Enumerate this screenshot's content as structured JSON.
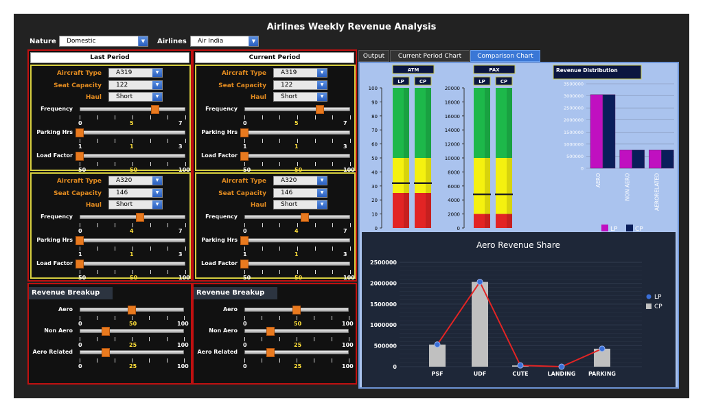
{
  "title": "Airlines Weekly Revenue Analysis",
  "filters": {
    "nature_label": "Nature",
    "nature_value": "Domestic",
    "airlines_label": "Airlines",
    "airlines_value": "Air India"
  },
  "periods": [
    {
      "header": "Last Period",
      "aircraft": [
        {
          "type_label": "Aircraft Type",
          "type_value": "A319",
          "seat_label": "Seat Capacity",
          "seat_value": "122",
          "haul_label": "Haul",
          "haul_value": "Short",
          "sliders": [
            {
              "label": "Frequency",
              "min": "0",
              "mid": "5",
              "max": "7",
              "frac": 0.714
            },
            {
              "label": "Parking Hrs",
              "min": "1",
              "mid": "1",
              "max": "3",
              "frac": 0.0
            },
            {
              "label": "Load Factor",
              "min": "50",
              "mid": "50",
              "max": "100",
              "frac": 0.0
            }
          ]
        },
        {
          "type_label": "Aircraft Type",
          "type_value": "A320",
          "seat_label": "Seat Capacity",
          "seat_value": "146",
          "haul_label": "Haul",
          "haul_value": "Short",
          "sliders": [
            {
              "label": "Frequency",
              "min": "0",
              "mid": "4",
              "max": "7",
              "frac": 0.571
            },
            {
              "label": "Parking Hrs",
              "min": "1",
              "mid": "1",
              "max": "3",
              "frac": 0.0
            },
            {
              "label": "Load Factor",
              "min": "50",
              "mid": "50",
              "max": "100",
              "frac": 0.0
            }
          ]
        }
      ],
      "revenue": {
        "title": "Revenue Breakup",
        "sliders": [
          {
            "label": "Aero",
            "min": "0",
            "mid": "50",
            "max": "100",
            "frac": 0.5
          },
          {
            "label": "Non Aero",
            "min": "0",
            "mid": "25",
            "max": "100",
            "frac": 0.25
          },
          {
            "label": "Aero Related",
            "min": "0",
            "mid": "25",
            "max": "100",
            "frac": 0.25
          }
        ]
      }
    },
    {
      "header": "Current Period",
      "aircraft": [
        {
          "type_label": "Aircraft Type",
          "type_value": "A319",
          "seat_label": "Seat Capacity",
          "seat_value": "122",
          "haul_label": "Haul",
          "haul_value": "Short",
          "sliders": [
            {
              "label": "Frequency",
              "min": "0",
              "mid": "5",
              "max": "7",
              "frac": 0.714
            },
            {
              "label": "Parking Hrs",
              "min": "1",
              "mid": "1",
              "max": "3",
              "frac": 0.0
            },
            {
              "label": "Load Factor",
              "min": "50",
              "mid": "50",
              "max": "100",
              "frac": 0.0
            }
          ]
        },
        {
          "type_label": "Aircraft Type",
          "type_value": "A320",
          "seat_label": "Seat Capacity",
          "seat_value": "146",
          "haul_label": "Haul",
          "haul_value": "Short",
          "sliders": [
            {
              "label": "Frequency",
              "min": "0",
              "mid": "4",
              "max": "7",
              "frac": 0.571
            },
            {
              "label": "Parking Hrs",
              "min": "1",
              "mid": "1",
              "max": "3",
              "frac": 0.0
            },
            {
              "label": "Load Factor",
              "min": "50",
              "mid": "50",
              "max": "100",
              "frac": 0.0
            }
          ]
        }
      ],
      "revenue": {
        "title": "Revenue Breakup",
        "sliders": [
          {
            "label": "Aero",
            "min": "0",
            "mid": "50",
            "max": "100",
            "frac": 0.5
          },
          {
            "label": "Non Aero",
            "min": "0",
            "mid": "25",
            "max": "100",
            "frac": 0.25
          },
          {
            "label": "Aero Related",
            "min": "0",
            "mid": "25",
            "max": "100",
            "frac": 0.25
          }
        ]
      }
    }
  ],
  "tabs": [
    {
      "label": "Output",
      "active": false
    },
    {
      "label": "Current Period Chart",
      "active": false
    },
    {
      "label": "Comparison Chart",
      "active": true
    }
  ],
  "chart_data": [
    {
      "type": "bar",
      "title": "ATM",
      "series_labels": [
        "LP",
        "CP"
      ],
      "ylim": [
        0,
        100
      ],
      "ticks": [
        "0",
        "10",
        "20",
        "30",
        "40",
        "50",
        "60",
        "70",
        "80",
        "90",
        "100"
      ],
      "bands": {
        "red": [
          0,
          25
        ],
        "yellow": [
          25,
          50
        ],
        "green": [
          50,
          100
        ]
      },
      "values": {
        "LP": 32,
        "CP": 32
      }
    },
    {
      "type": "bar",
      "title": "PAX",
      "series_labels": [
        "LP",
        "CP"
      ],
      "ylim": [
        0,
        20000
      ],
      "ticks": [
        "0",
        "2000",
        "4000",
        "6000",
        "8000",
        "10000",
        "12000",
        "14000",
        "16000",
        "18000",
        "20000"
      ],
      "bands": {
        "red": [
          0,
          2000
        ],
        "yellow": [
          2000,
          10000
        ],
        "green": [
          10000,
          20000
        ]
      },
      "values": {
        "LP": 4800,
        "CP": 4800
      }
    },
    {
      "type": "bar",
      "title": "Revenue Distribution",
      "categories": [
        "AERO",
        "NON AERO",
        "AERORELATED"
      ],
      "ticks": [
        "0",
        "500000",
        "1000000",
        "1500000",
        "2000000",
        "2500000",
        "3000000",
        "3500000"
      ],
      "ylim": [
        0,
        3500000
      ],
      "series": [
        {
          "name": "LP",
          "color": "#c010c0",
          "values": [
            3050000,
            760000,
            760000
          ]
        },
        {
          "name": "CP",
          "color": "#0a1e5a",
          "values": [
            3050000,
            760000,
            760000
          ]
        }
      ]
    },
    {
      "type": "bar",
      "title": "Aero Revenue Share",
      "categories": [
        "PSF",
        "UDF",
        "CUTE",
        "LANDING",
        "PARKING"
      ],
      "ticks": [
        "0",
        "500000",
        "1000000",
        "1500000",
        "2000000",
        "2500000"
      ],
      "ylim": [
        0,
        2500000
      ],
      "series": [
        {
          "name": "LP",
          "type": "line",
          "color": "#3a6fd8",
          "values": [
            530000,
            2030000,
            30000,
            0,
            430000
          ]
        },
        {
          "name": "CP",
          "type": "bar",
          "color": "#c0c0c0",
          "values": [
            530000,
            2030000,
            30000,
            0,
            430000
          ]
        }
      ]
    }
  ]
}
